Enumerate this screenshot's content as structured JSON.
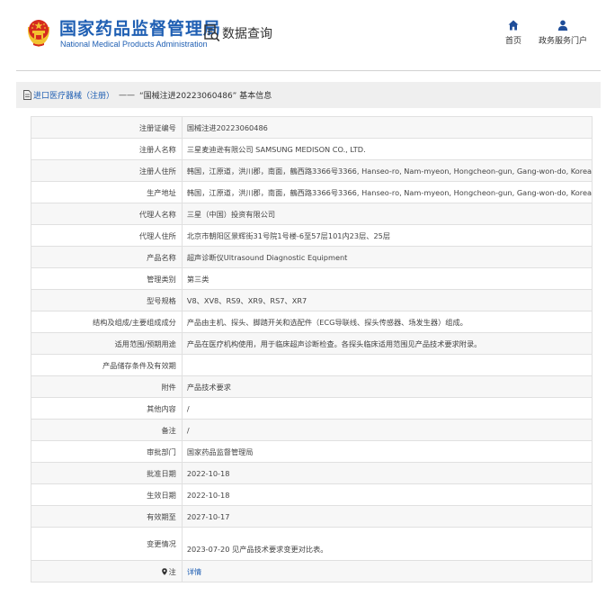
{
  "header": {
    "logo_cn": "国家药品监督管理局",
    "logo_en": "National Medical Products Administration",
    "query_label": "数据查询",
    "nav": [
      {
        "label": "首页",
        "icon": "home-icon"
      },
      {
        "label": "政务服务门户",
        "icon": "user-icon"
      }
    ]
  },
  "breadcrumb": {
    "link": "进口医疗器械（注册）",
    "separator": "——",
    "current": "“国械注进20223060486” 基本信息"
  },
  "details": [
    {
      "key": "注册证编号",
      "value": "国械注进20223060486"
    },
    {
      "key": "注册人名称",
      "value": "三星麦迪逊有限公司 SAMSUNG MEDISON CO., LTD."
    },
    {
      "key": "注册人住所",
      "value": "韩国，江原道，洪川郡，南面，鶴西路3366号3366, Hanseo-ro, Nam-myeon, Hongcheon-gun, Gang-won-do, Korea"
    },
    {
      "key": "生产地址",
      "value": "韩国，江原道，洪川郡，南面，鶴西路3366号3366, Hanseo-ro, Nam-myeon, Hongcheon-gun, Gang-won-do, Korea"
    },
    {
      "key": "代理人名称",
      "value": "三星（中国）投资有限公司"
    },
    {
      "key": "代理人住所",
      "value": "北京市朝阳区景辉街31号院1号楼-6至57层101内23层、25层"
    },
    {
      "key": "产品名称",
      "value": "超声诊断仪Ultrasound Diagnostic Equipment"
    },
    {
      "key": "管理类别",
      "value": "第三类"
    },
    {
      "key": "型号规格",
      "value": "V8、XV8、RS9、XR9、RS7、XR7"
    },
    {
      "key": "结构及组成/主要组成成分",
      "value": "产品由主机、探头、脚踏开关和选配件（ECG导联线、探头传感器、场发生器）组成。"
    },
    {
      "key": "适用范围/预期用途",
      "value": "产品在医疗机构使用，用于临床超声诊断检查。各探头临床适用范围见产品技术要求附录。"
    },
    {
      "key": "产品储存条件及有效期",
      "value": ""
    },
    {
      "key": "附件",
      "value": "产品技术要求"
    },
    {
      "key": "其他内容",
      "value": "/"
    },
    {
      "key": "备注",
      "value": "/"
    },
    {
      "key": "审批部门",
      "value": "国家药品监督管理局"
    },
    {
      "key": "批准日期",
      "value": "2022-10-18"
    },
    {
      "key": "生效日期",
      "value": "2022-10-18"
    },
    {
      "key": "有效期至",
      "value": "2027-10-17"
    },
    {
      "key": "变更情况",
      "value": "2023-07-20 见产品技术要求变更对比表。"
    },
    {
      "key": "注",
      "value": "详情"
    }
  ],
  "colors": {
    "brand_blue": "#1f5fb3",
    "breadcrumb_bg": "#efefef",
    "row_stripe": "#f7f7f7",
    "border": "#e0e0e0",
    "emblem_red": "#d52b1e",
    "emblem_gold": "#f2c230"
  }
}
